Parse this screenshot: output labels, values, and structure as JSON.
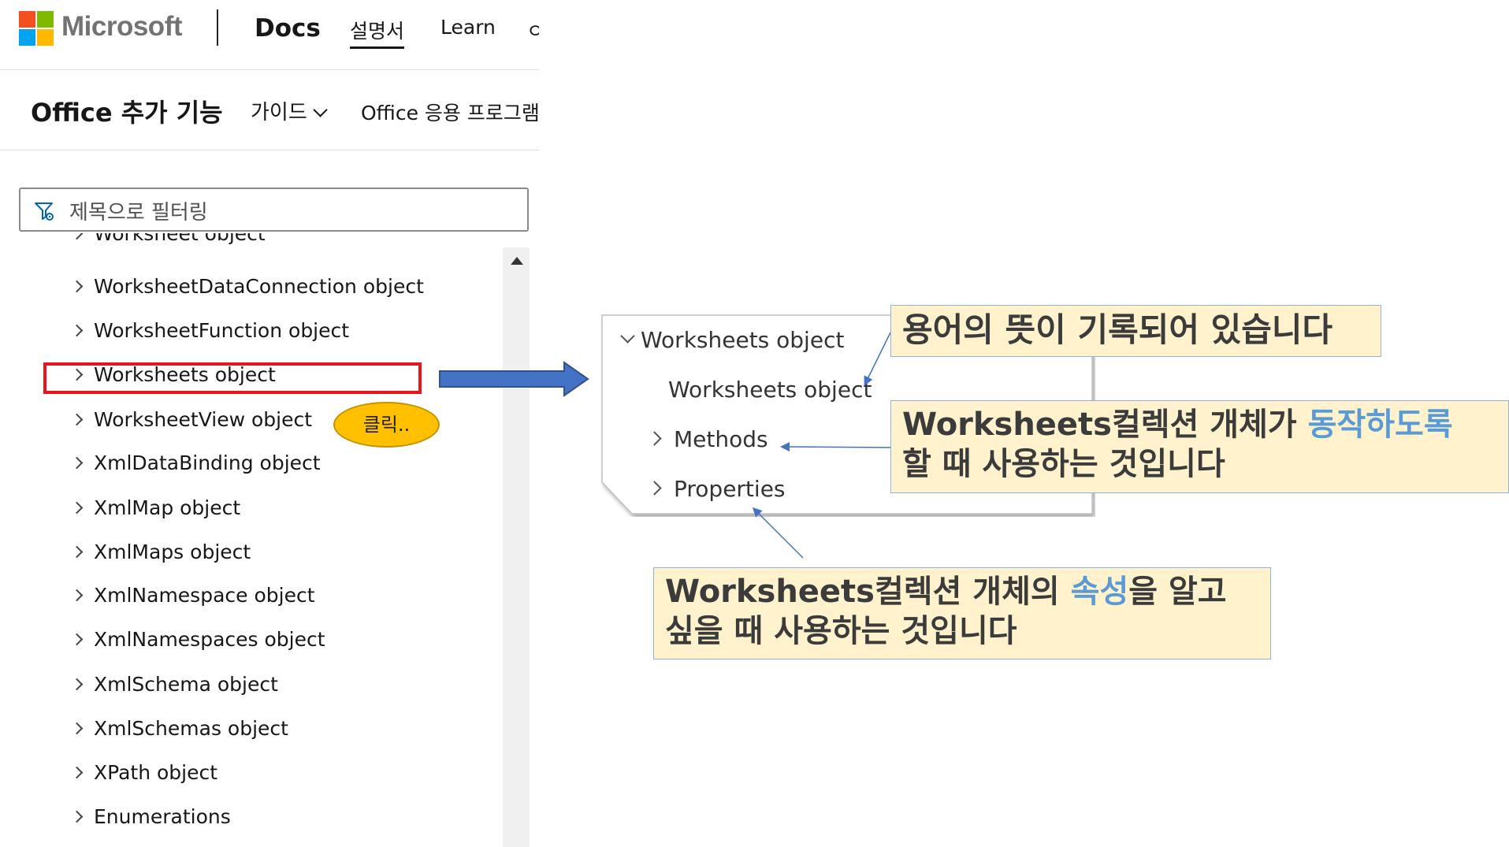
{
  "header": {
    "brand": "Microsoft",
    "docs": "Docs",
    "nav_items": [
      "설명서",
      "Learn",
      "ㅇ"
    ],
    "logo_colors": [
      "#f25022",
      "#7fba00",
      "#00a4ef",
      "#ffb900"
    ]
  },
  "subnav": {
    "title": "Office 추가 기능",
    "guide": "가이드",
    "office_apps": "Office 응용 프로그램"
  },
  "filter": {
    "placeholder": "제목으로 필터링"
  },
  "toc": {
    "partial_top": "Worksheet object",
    "items": [
      "WorksheetDataConnection object",
      "WorksheetFunction object",
      "Worksheets object",
      "WorksheetView object",
      "XmlDataBinding object",
      "XmlMap object",
      "XmlMaps object",
      "XmlNamespace object",
      "XmlNamespaces object",
      "XmlSchema object",
      "XmlSchemas object",
      "XPath object",
      "Enumerations"
    ],
    "selected": "Worksheets object"
  },
  "click_label": "클릭..",
  "zoom": {
    "parent": "Worksheets object",
    "child": "Worksheets object",
    "methods": "Methods",
    "properties": "Properties"
  },
  "callouts": {
    "c1": "용어의 뜻이 기록되어 있습니다",
    "c2_en": "Worksheets",
    "c2_a": "컬렉션 개체가 ",
    "c2_blue": "동작하도록",
    "c2_b": "할 때 사용하는 것입니다",
    "c3_en": "Worksheets",
    "c3_a": "컬렉션 개체의 ",
    "c3_blue": "속성",
    "c3_b": "을 알고",
    "c3_c": "싶을 때 사용하는 것입니다"
  },
  "colors": {
    "highlight_red": "#e8161b",
    "arrow_blue": "#4472c4",
    "bubble_yellow": "#ffc000",
    "callout_fill": "#fff2cc",
    "callout_blue_text": "#5b9bd5"
  }
}
